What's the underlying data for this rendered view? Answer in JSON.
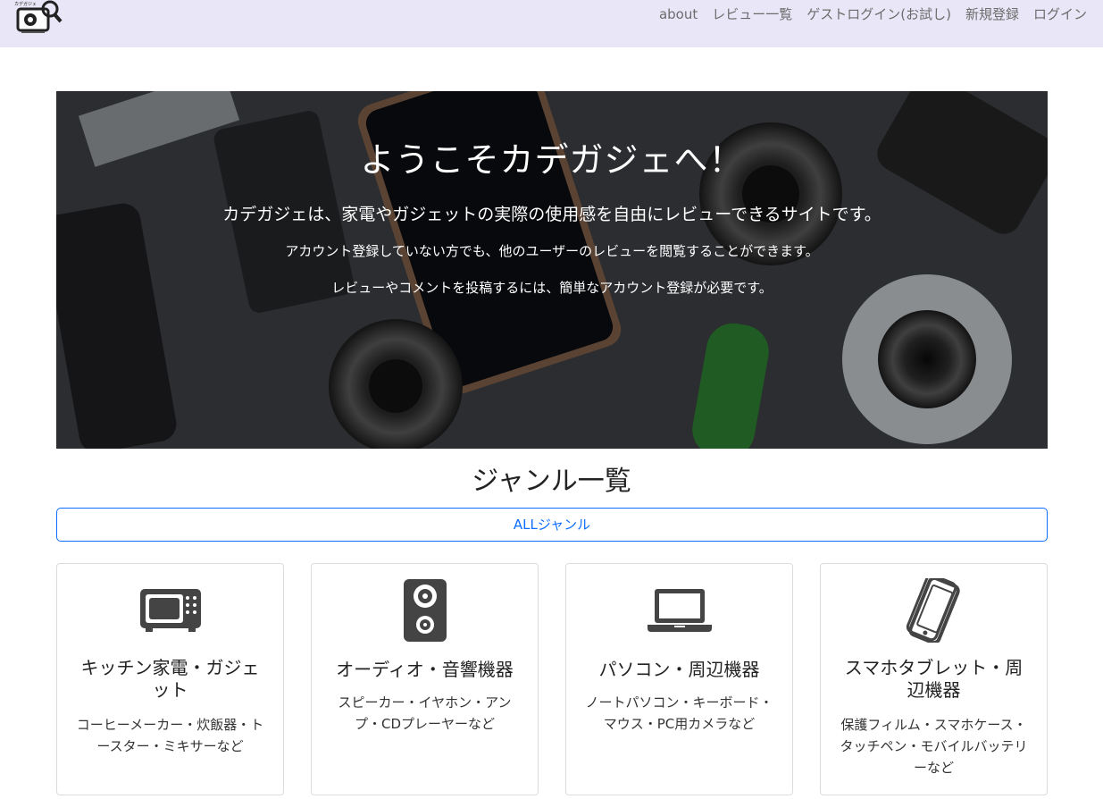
{
  "header": {
    "logo_text": "カデガジェ",
    "nav": [
      "about",
      "レビュー一覧",
      "ゲストログイン(お試し)",
      "新規登録",
      "ログイン"
    ]
  },
  "hero": {
    "title": "ようこそカデガジェへ！",
    "lead": "カデガジェは、家電やガジェットの実際の使用感を自由にレビューできるサイトです。",
    "sub1": "アカウント登録していない方でも、他のユーザーのレビューを閲覧することができます。",
    "sub2": "レビューやコメントを投稿するには、簡単なアカウント登録が必要です。"
  },
  "genres": {
    "title": "ジャンル一覧",
    "all_label": "ALLジャンル",
    "accent": "#0d6efd",
    "cards": [
      {
        "icon": "microwave-icon",
        "title": "キッチン家電・ガジェット",
        "desc": "コーヒーメーカー・炊飯器・トースター・ミキサーなど"
      },
      {
        "icon": "speaker-icon",
        "title": "オーディオ・音響機器",
        "desc": "スピーカー・イヤホン・アンプ・CDプレーヤーなど"
      },
      {
        "icon": "laptop-icon",
        "title": "パソコン・周辺機器",
        "desc": "ノートパソコン・キーボード・マウス・PC用カメラなど"
      },
      {
        "icon": "smartphone-icon",
        "title": "スマホタブレット・周辺機器",
        "desc": "保護フィルム・スマホケース・タッチペン・モバイルバッテリーなど"
      }
    ]
  }
}
